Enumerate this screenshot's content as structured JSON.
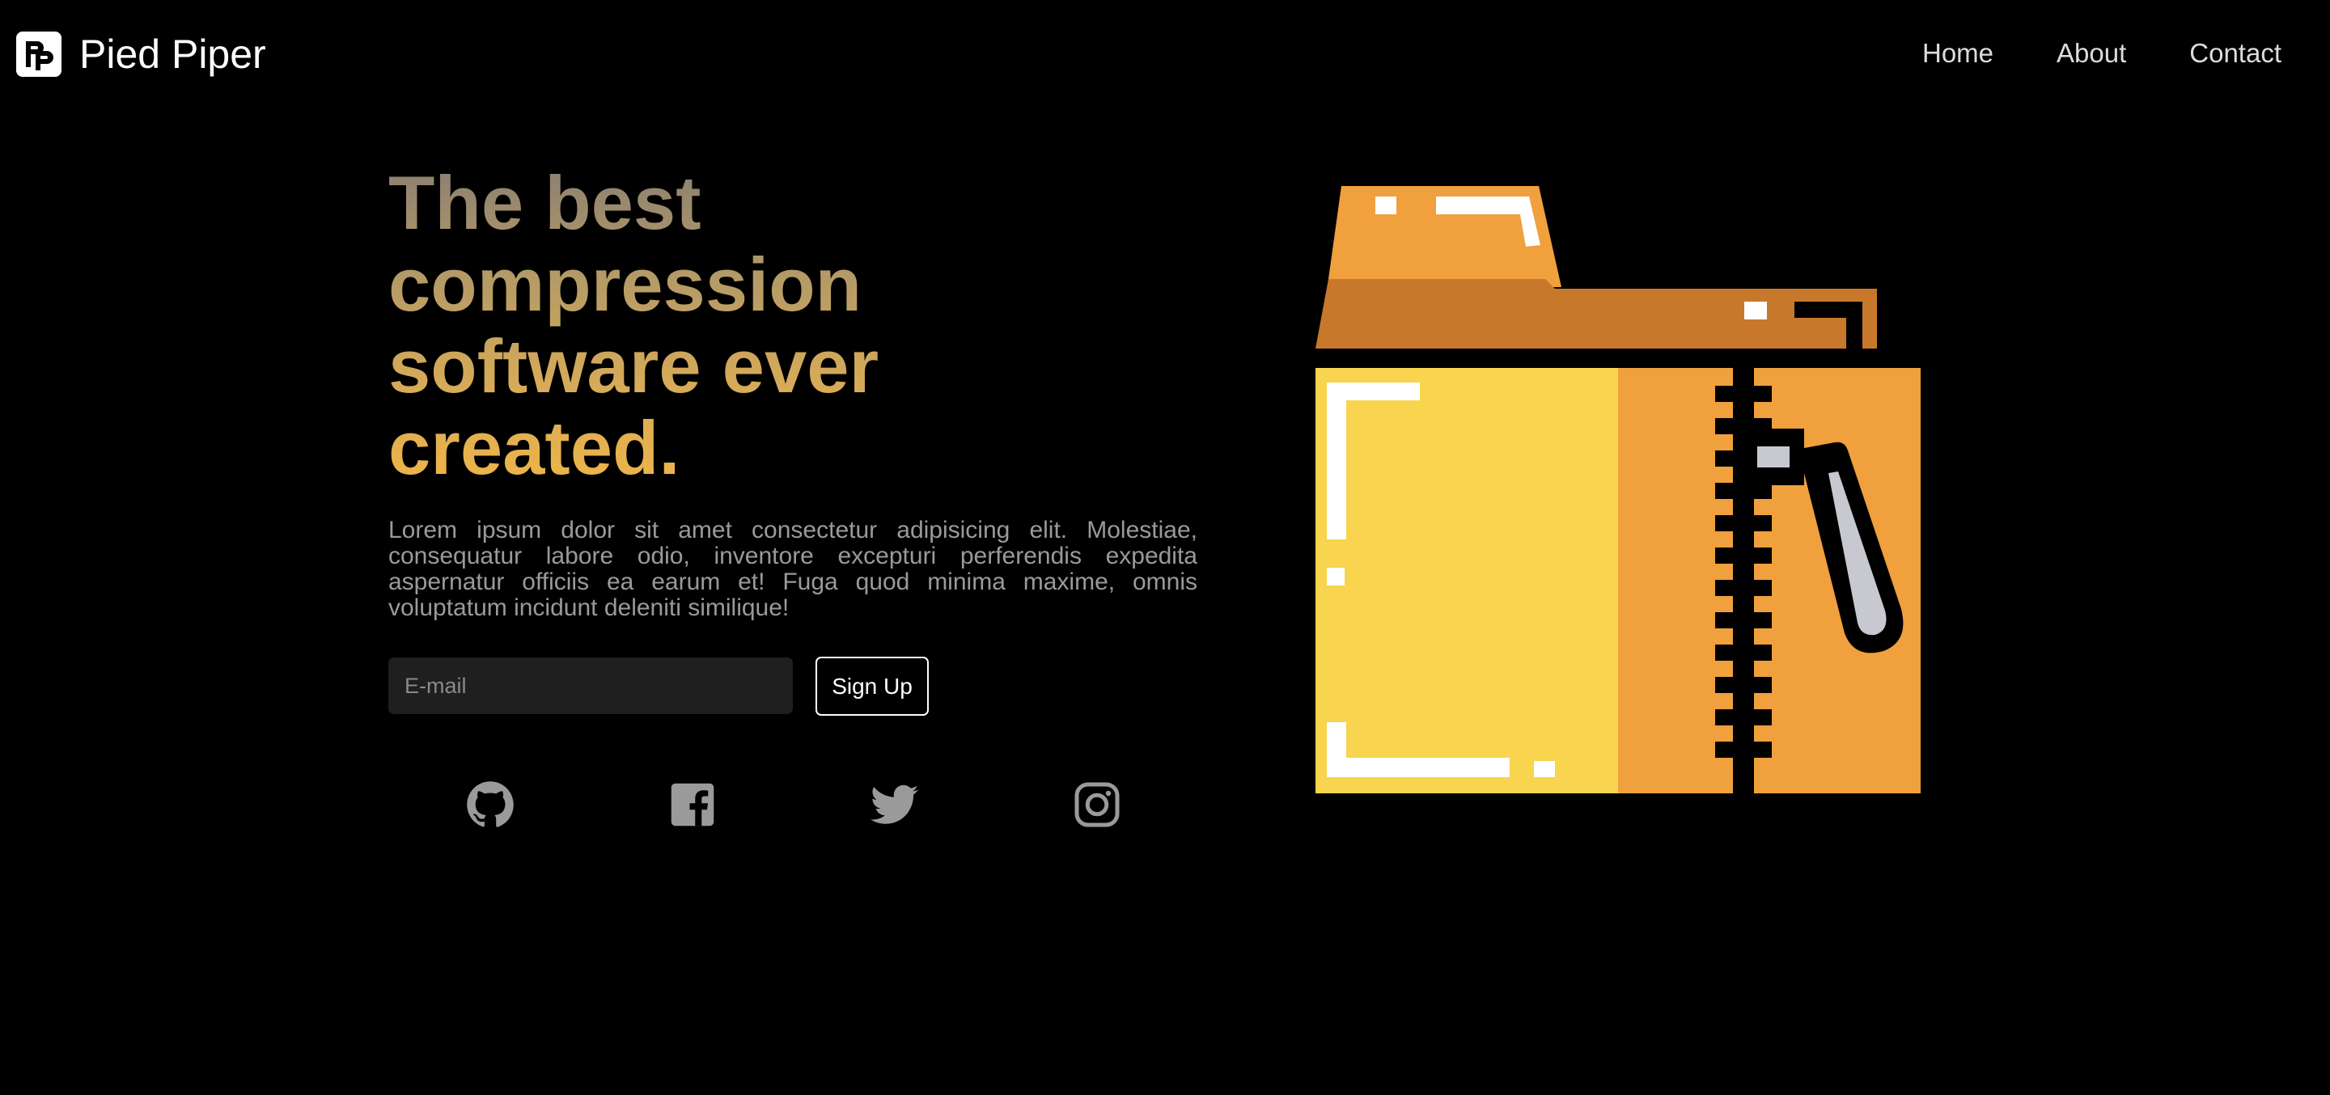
{
  "header": {
    "brand": {
      "logo_icon": "pied-piper-logo-icon",
      "name": "Pied Piper"
    },
    "nav": [
      {
        "label": "Home"
      },
      {
        "label": "About"
      },
      {
        "label": "Contact"
      }
    ]
  },
  "hero": {
    "title": "The best compression software ever created.",
    "description": "Lorem ipsum dolor sit amet consectetur adipisicing elit. Molestiae, consequatur labore odio, inventore excepturi perferendis expedita aspernatur officiis ea earum et! Fuga quod minima maxime, omnis voluptatum incidunt deleniti similique!",
    "title_gradient": [
      "#8a7f72",
      "#eeb548"
    ]
  },
  "signup": {
    "email_placeholder": "E-mail",
    "email_value": "",
    "button_label": "Sign Up"
  },
  "social": [
    {
      "icon": "github-icon"
    },
    {
      "icon": "facebook-icon"
    },
    {
      "icon": "twitter-icon"
    },
    {
      "icon": "instagram-icon"
    }
  ],
  "illustration": {
    "icon": "zipped-folder-icon",
    "colors": {
      "folder_tab": "#f0a03c",
      "folder_tab_shadow": "#c8782a",
      "folder_front_left": "#f8d44f",
      "folder_front_right": "#f0a03c",
      "zipper": "#000000",
      "zipper_pull": "#c8c8d0"
    }
  },
  "theme": {
    "background": "#000000",
    "text": "#ffffff",
    "nav_text": "#dcdcdc",
    "body_text": "#9a9a9a",
    "input_bg": "#1f1f1f",
    "icon_color": "#9a9a9a"
  }
}
